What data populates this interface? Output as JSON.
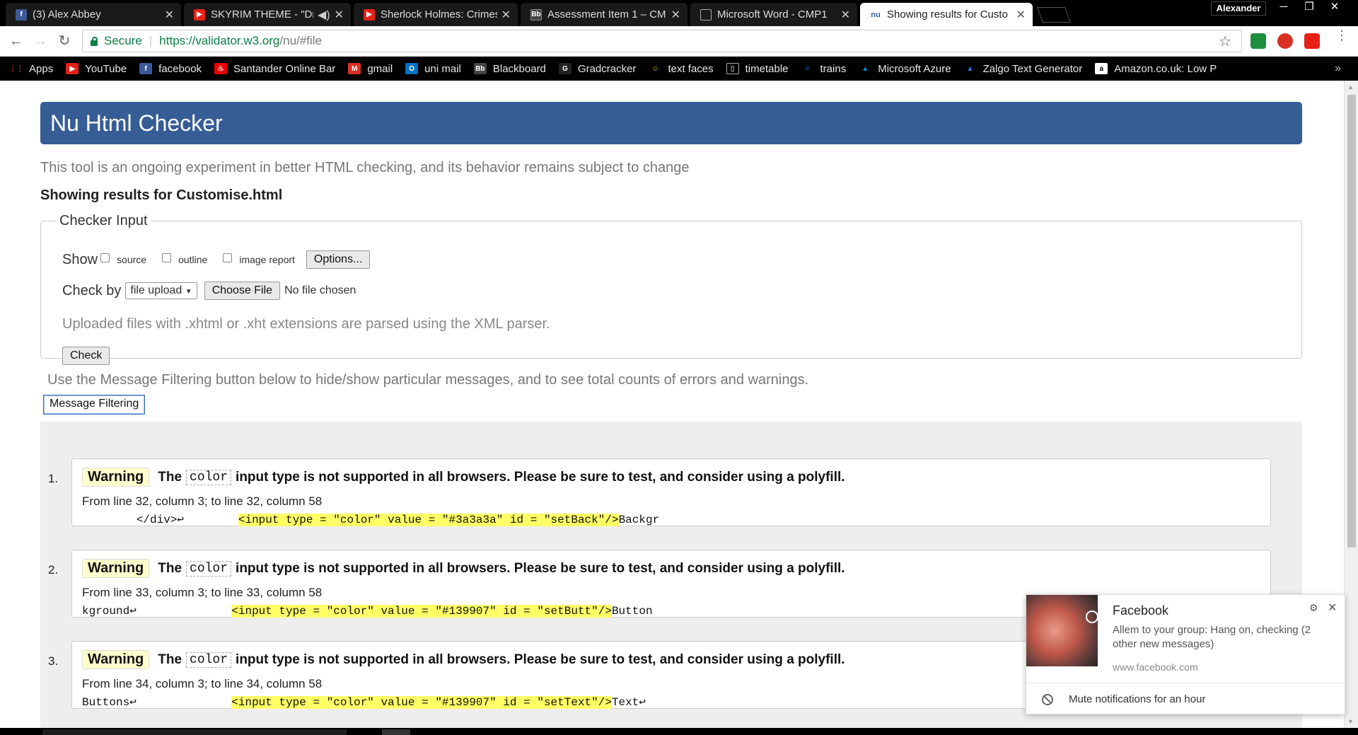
{
  "browser": {
    "tabs": [
      {
        "title": "(3) Alex Abbey",
        "favicon": "facebook-icon",
        "color": "#3b5998",
        "glyph": "f"
      },
      {
        "title": "SKYRIM THEME - \"Dra",
        "favicon": "youtube-icon",
        "color": "#e62117",
        "glyph": "▶"
      },
      {
        "title": "Sherlock Holmes: Crimes",
        "favicon": "youtube-icon",
        "color": "#e62117",
        "glyph": "▶"
      },
      {
        "title": "Assessment Item 1 – CM",
        "favicon": "blackboard-icon",
        "color": "#444444",
        "glyph": "Bb"
      },
      {
        "title": "Microsoft Word - CMP1",
        "favicon": "document-icon",
        "color": "#ffffff",
        "glyph": "▯"
      },
      {
        "title": "Showing results for Custo",
        "favicon": "nu-icon",
        "color": "#ffffff",
        "glyph": "nu"
      }
    ],
    "user": "Alexander",
    "secure_label": "Secure",
    "url_host": "https://validator.w3.org",
    "url_path": "/nu/#file",
    "bookmarks": [
      {
        "label": "Apps",
        "icon": "apps-grid-icon",
        "color": "#e8453c"
      },
      {
        "label": "YouTube",
        "icon": "youtube-icon",
        "color": "#e62117"
      },
      {
        "label": "facebook",
        "icon": "facebook-icon",
        "color": "#3b5998"
      },
      {
        "label": "Santander Online Bar",
        "icon": "santander-icon",
        "color": "#ec0000"
      },
      {
        "label": "gmail",
        "icon": "gmail-icon",
        "color": "#d93025"
      },
      {
        "label": "uni mail",
        "icon": "outlook-icon",
        "color": "#0072c6"
      },
      {
        "label": "Blackboard",
        "icon": "blackboard-icon",
        "color": "#444444"
      },
      {
        "label": "Gradcracker",
        "icon": "gradcracker-icon",
        "color": "#222222"
      },
      {
        "label": "text faces",
        "icon": "smiley-icon",
        "color": "#f5c518"
      },
      {
        "label": "timetable",
        "icon": "document-icon",
        "color": "#000000"
      },
      {
        "label": "trains",
        "icon": "trains-icon",
        "color": "#1d5ea8"
      },
      {
        "label": "Microsoft Azure",
        "icon": "azure-icon",
        "color": "#0089d6"
      },
      {
        "label": "Zalgo Text Generator",
        "icon": "zalgo-icon",
        "color": "#2a7de1"
      },
      {
        "label": "Amazon.co.uk: Low P",
        "icon": "amazon-icon",
        "color": "#ffffff"
      }
    ]
  },
  "page": {
    "header": "Nu Html Checker",
    "subtitle": "This tool is an ongoing experiment in better HTML checking, and its behavior remains subject to change",
    "showing": "Showing results for Customise.html",
    "checker_legend": "Checker Input",
    "show_label": "Show",
    "show_options": [
      "source",
      "outline",
      "image report"
    ],
    "options_button": "Options...",
    "check_by_label": "Check by",
    "check_by_value": "file upload",
    "choose_file_button": "Choose File",
    "no_file": "No file chosen",
    "upload_note": "Uploaded files with .xhtml or .xht extensions are parsed using the XML parser.",
    "check_button": "Check",
    "filter_note": "Use the Message Filtering button below to hide/show particular messages, and to see total counts of errors and warnings.",
    "filter_button": "Message Filtering"
  },
  "messages": [
    {
      "num": "1.",
      "type": "Warning",
      "pre": "The",
      "code": "color",
      "post": "input type is not supported in all browsers. Please be sure to test, and consider using a polyfill.",
      "location": "From line 32, column 3; to line 32, column 58",
      "ext_before": "        </div>↩        ",
      "ext_hl": "<input type = \"color\" value = \"#3a3a3a\" id = \"setBack\"/>",
      "ext_after": "Backgr"
    },
    {
      "num": "2.",
      "type": "Warning",
      "pre": "The",
      "code": "color",
      "post": "input type is not supported in all browsers. Please be sure to test, and consider using a polyfill.",
      "location": "From line 33, column 3; to line 33, column 58",
      "ext_before": "kground↩              ",
      "ext_hl": "<input type = \"color\" value = \"#139907\" id = \"setButt\"/>",
      "ext_after": "Button"
    },
    {
      "num": "3.",
      "type": "Warning",
      "pre": "The",
      "code": "color",
      "post": "input type is not supported in all browsers. Please be sure to test, and consider using a polyfill.",
      "location": "From line 34, column 3; to line 34, column 58",
      "ext_before": "Buttons↩              ",
      "ext_hl": "<input type = \"color\" value = \"#139907\" id = \"setText\"/>",
      "ext_after": "Text↩"
    }
  ],
  "notification": {
    "title": "Facebook",
    "body": "Allem to your group: Hang on, checking (2 other new messages)",
    "site": "www.facebook.com",
    "mute": "Mute notifications for an hour"
  }
}
